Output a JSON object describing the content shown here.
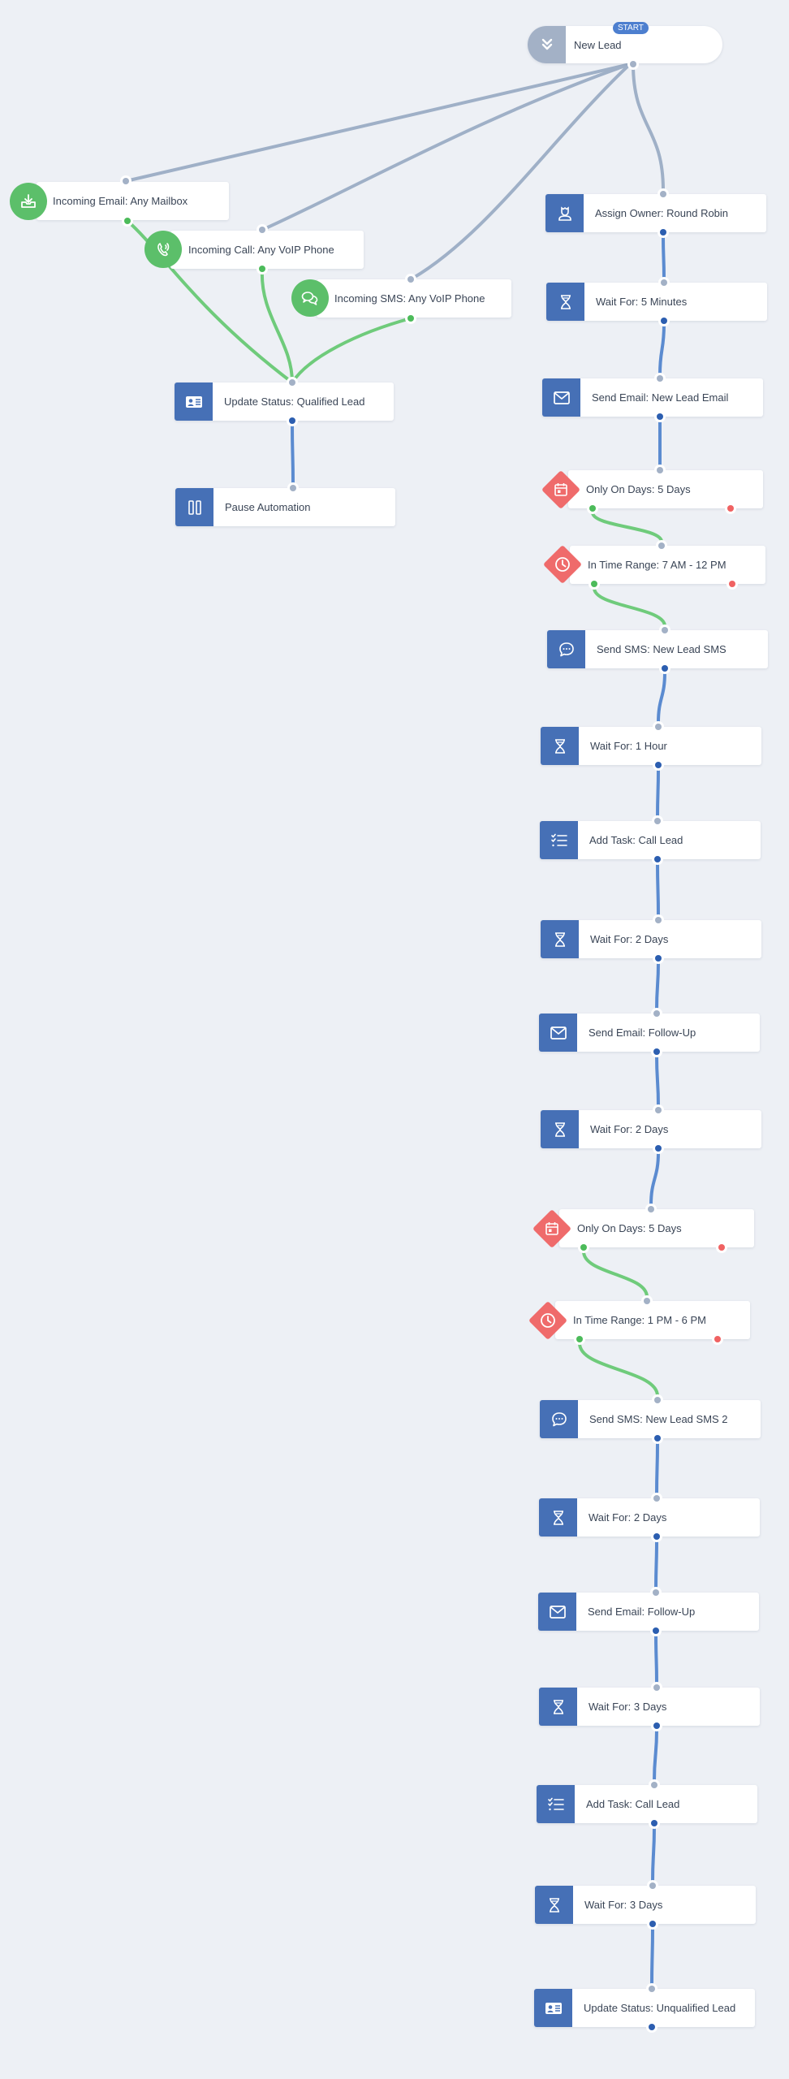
{
  "colors": {
    "background": "#edf0f5",
    "action": "#4670b6",
    "trigger": "#5cbf6a",
    "condition": "#ef6b6b",
    "start": "#a3b1c6",
    "wire_trigger": "#9fb0c7",
    "wire_action": "#5b8bd0",
    "wire_yes": "#6fcb7b"
  },
  "start": {
    "badge": "START",
    "label": "New Lead",
    "icon": "double-chevron-down-icon"
  },
  "triggers": [
    {
      "label": "Incoming Email: Any Mailbox",
      "icon": "inbox-download-icon"
    },
    {
      "label": "Incoming Call: Any VoIP Phone",
      "icon": "phone-ringing-icon"
    },
    {
      "label": "Incoming SMS: Any VoIP Phone",
      "icon": "chat-bubbles-icon"
    }
  ],
  "trigger_branch": [
    {
      "label": "Update Status: Qualified Lead",
      "icon": "id-card-icon"
    },
    {
      "label": "Pause Automation",
      "icon": "pause-icon"
    }
  ],
  "main_sequence": [
    {
      "type": "action",
      "label": "Assign Owner: Round Robin",
      "icon": "user-icon"
    },
    {
      "type": "action",
      "label": "Wait For: 5 Minutes",
      "icon": "hourglass-icon"
    },
    {
      "type": "action",
      "label": "Send Email: New Lead Email",
      "icon": "envelope-icon"
    },
    {
      "type": "condition",
      "label": "Only On Days: 5 Days",
      "icon": "calendar-icon"
    },
    {
      "type": "condition",
      "label": "In Time Range: 7 AM - 12 PM",
      "icon": "clock-icon"
    },
    {
      "type": "action",
      "label": "Send SMS: New Lead SMS",
      "icon": "chat-bubble-icon"
    },
    {
      "type": "action",
      "label": "Wait For: 1 Hour",
      "icon": "hourglass-icon"
    },
    {
      "type": "action",
      "label": "Add Task: Call Lead",
      "icon": "checklist-icon"
    },
    {
      "type": "action",
      "label": "Wait For: 2 Days",
      "icon": "hourglass-icon"
    },
    {
      "type": "action",
      "label": "Send Email: Follow-Up",
      "icon": "envelope-icon"
    },
    {
      "type": "action",
      "label": "Wait For: 2 Days",
      "icon": "hourglass-icon"
    },
    {
      "type": "condition",
      "label": "Only On Days: 5 Days",
      "icon": "calendar-icon"
    },
    {
      "type": "condition",
      "label": "In Time Range: 1 PM - 6 PM",
      "icon": "clock-icon"
    },
    {
      "type": "action",
      "label": "Send SMS: New Lead SMS 2",
      "icon": "chat-bubble-icon"
    },
    {
      "type": "action",
      "label": "Wait For: 2 Days",
      "icon": "hourglass-icon"
    },
    {
      "type": "action",
      "label": "Send Email: Follow-Up",
      "icon": "envelope-icon"
    },
    {
      "type": "action",
      "label": "Wait For: 3 Days",
      "icon": "hourglass-icon"
    },
    {
      "type": "action",
      "label": "Add Task: Call Lead",
      "icon": "checklist-icon"
    },
    {
      "type": "action",
      "label": "Wait For: 3 Days",
      "icon": "hourglass-icon"
    },
    {
      "type": "action",
      "label": "Update Status: Unqualified Lead",
      "icon": "id-card-icon"
    }
  ]
}
